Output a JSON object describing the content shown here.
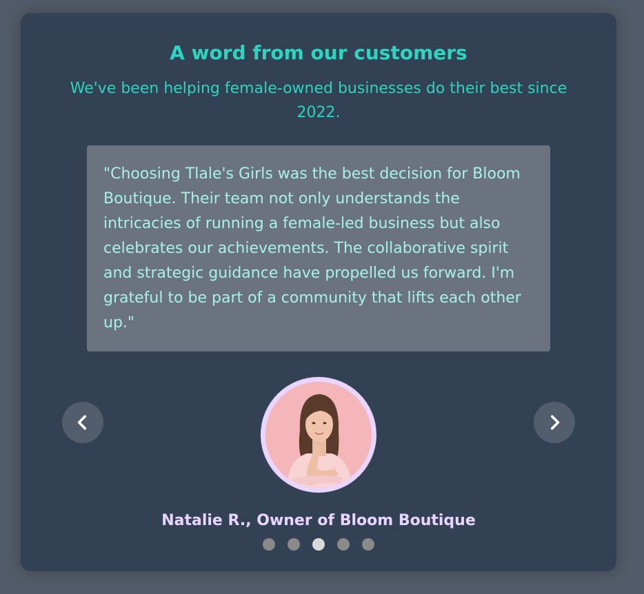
{
  "section": {
    "title": "A word from our customers",
    "subtitle": "We've been helping female-owned businesses do their best since 2022."
  },
  "testimonial": {
    "quote": "\"Choosing Tlale's Girls was the best decision for Bloom Boutique. Their team not only understands the intricacies of running a female-led business but also celebrates our achievements. The collaborative spirit and strategic guidance have propelled us forward. I'm grateful to be part of a community that lifts each other up.\"",
    "author": "Natalie R., Owner of Bloom Boutique"
  },
  "carousel": {
    "prev_icon": "chevron-left-icon",
    "next_icon": "chevron-right-icon",
    "dot_count": 5,
    "active_index": 2
  },
  "colors": {
    "page_bg": "#525b69",
    "card_bg": "#334155",
    "accent": "#2dd4bf",
    "quote_text": "#a7f3e6",
    "quote_bg": "#6b7280",
    "author_text": "#e9d5ff",
    "dot_active": "#d9d9d9",
    "dot_inactive": "#8a8a8a"
  }
}
